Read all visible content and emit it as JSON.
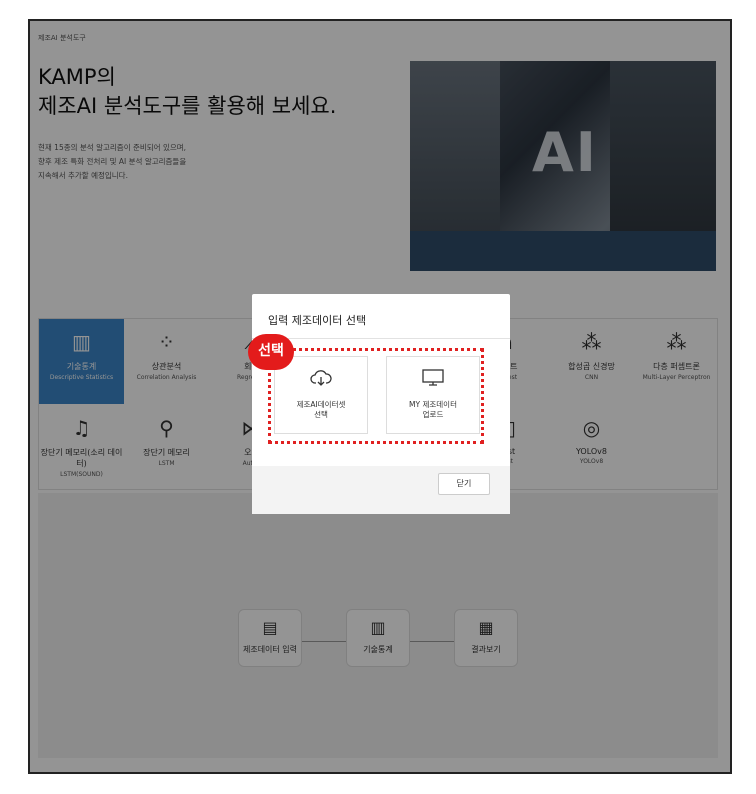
{
  "breadcrumb": "제조AI 분석도구",
  "hero": {
    "title_line1": "KAMP의",
    "title_line2": "제조AI 분석도구를 활용해 보세요.",
    "desc_line1": "현재 15종의 분석 알고리즘이 준비되어 있으며,",
    "desc_line2": "향후 제조 특화 전처리 및 AI 분석 알고리즘들을",
    "desc_line3": "지속해서 추가할 예정입니다.",
    "image_text": "AI"
  },
  "tools": [
    {
      "label": "기술통계",
      "en": "Descriptive Statistics",
      "icon": "bar-chart-icon"
    },
    {
      "label": "상관분석",
      "en": "Correlation Analysis",
      "icon": "scatter-icon"
    },
    {
      "label": "회귀",
      "en": "Regressio",
      "icon": "regression-icon"
    },
    {
      "label": "레스트",
      "en": "nforest",
      "icon": "tree-icon"
    },
    {
      "label": "합성곱 신경망",
      "en": "CNN",
      "icon": "network-icon"
    },
    {
      "label": "다층 퍼셉트론",
      "en": "Multi-Layer Perceptron",
      "icon": "network-icon"
    },
    {
      "label": "장단기 메모리(소리 데이터)",
      "en": "LSTM(SOUND)",
      "icon": "sound-icon"
    },
    {
      "label": "장단기 메모리",
      "en": "LSTM",
      "icon": "lstm-icon"
    },
    {
      "label": "오토",
      "en": "AutoE",
      "icon": "autoencoder-icon"
    },
    {
      "label": "post",
      "en": "post",
      "icon": "boost-icon"
    },
    {
      "label": "YOLOv8",
      "en": "YOLOv8",
      "icon": "detect-icon"
    }
  ],
  "flow": {
    "step1": "제조데이터 입력",
    "step2": "기술통계",
    "step3": "결과보기"
  },
  "modal": {
    "title": "입력 제조데이터 선택",
    "option1_line1": "제조AI데이터셋",
    "option1_line2": "선택",
    "option2_line1": "MY 제조데이터",
    "option2_line2": "업로드",
    "close_label": "닫기"
  },
  "annotation": {
    "tag": "선택",
    "color": "#e31b1b"
  }
}
